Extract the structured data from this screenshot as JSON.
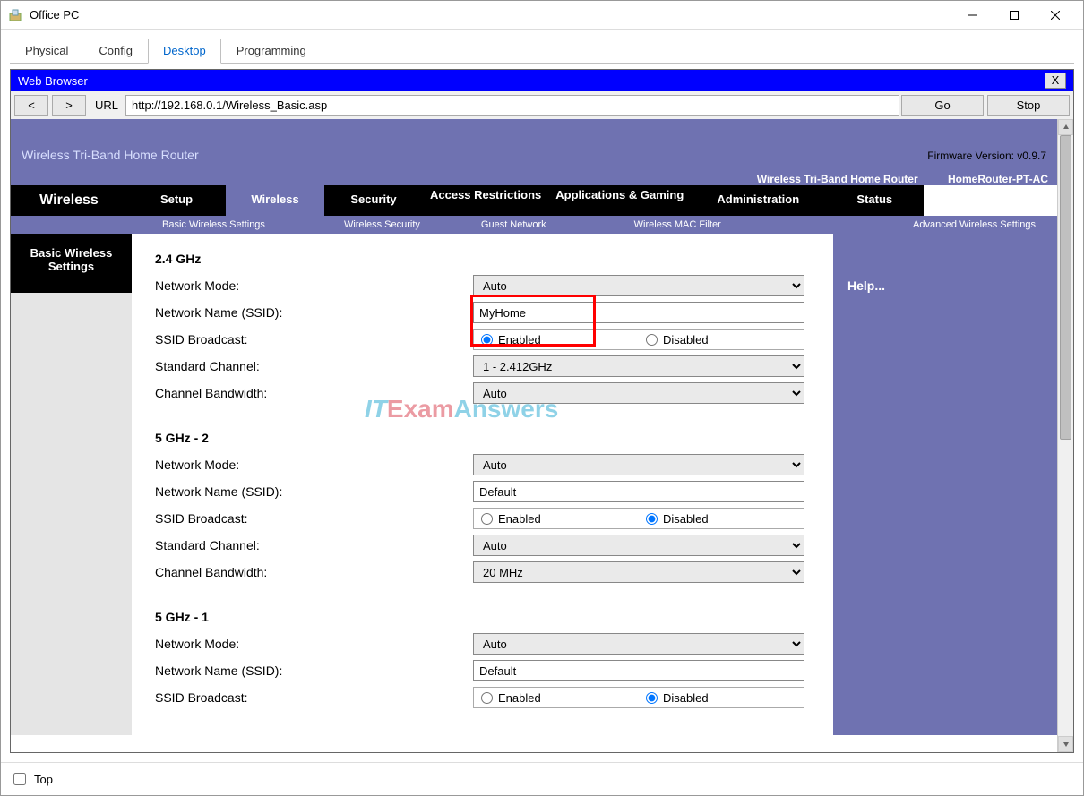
{
  "window": {
    "title": "Office PC"
  },
  "tabs": {
    "items": [
      "Physical",
      "Config",
      "Desktop",
      "Programming"
    ],
    "active": 2
  },
  "browser": {
    "title": "Web Browser",
    "close": "X",
    "back": "<",
    "forward": ">",
    "url_label": "URL",
    "url": "http://192.168.0.1/Wireless_Basic.asp",
    "go": "Go",
    "stop": "Stop"
  },
  "router": {
    "banner": "Wireless Tri-Band Home Router",
    "firmware": "Firmware Version: v0.9.7",
    "model_line_a": "Wireless Tri-Band Home Router",
    "model_line_b": "HomeRouter-PT-AC",
    "section": "Wireless",
    "main_tabs": [
      "Setup",
      "Wireless",
      "Security",
      "Access Restrictions",
      "Applications & Gaming",
      "Administration",
      "Status"
    ],
    "main_active": 1,
    "sub_tabs": [
      "Basic Wireless Settings",
      "Wireless Security",
      "Guest Network",
      "Wireless MAC Filter",
      "Advanced Wireless Settings"
    ],
    "side_label": "Basic Wireless Settings",
    "help": "Help...",
    "labels": {
      "network_mode": "Network Mode:",
      "ssid": "Network Name (SSID):",
      "broadcast": "SSID Broadcast:",
      "channel": "Standard Channel:",
      "bandwidth": "Channel Bandwidth:",
      "enabled": "Enabled",
      "disabled": "Disabled"
    },
    "bands": [
      {
        "title": "2.4 GHz",
        "mode": "Auto",
        "ssid": "MyHome",
        "broadcast": "enabled",
        "channel": "1 - 2.412GHz",
        "bandwidth": "Auto",
        "highlight": true
      },
      {
        "title": "5 GHz - 2",
        "mode": "Auto",
        "ssid": "Default",
        "broadcast": "disabled",
        "channel": "Auto",
        "bandwidth": "20 MHz",
        "highlight": false
      },
      {
        "title": "5 GHz - 1",
        "mode": "Auto",
        "ssid": "Default",
        "broadcast": "disabled",
        "channel": "",
        "bandwidth": "",
        "highlight": false
      }
    ]
  },
  "watermark": {
    "it": "IT",
    "ex": "Exam",
    "ans": "Answers"
  },
  "bottom": {
    "top_label": "Top"
  }
}
